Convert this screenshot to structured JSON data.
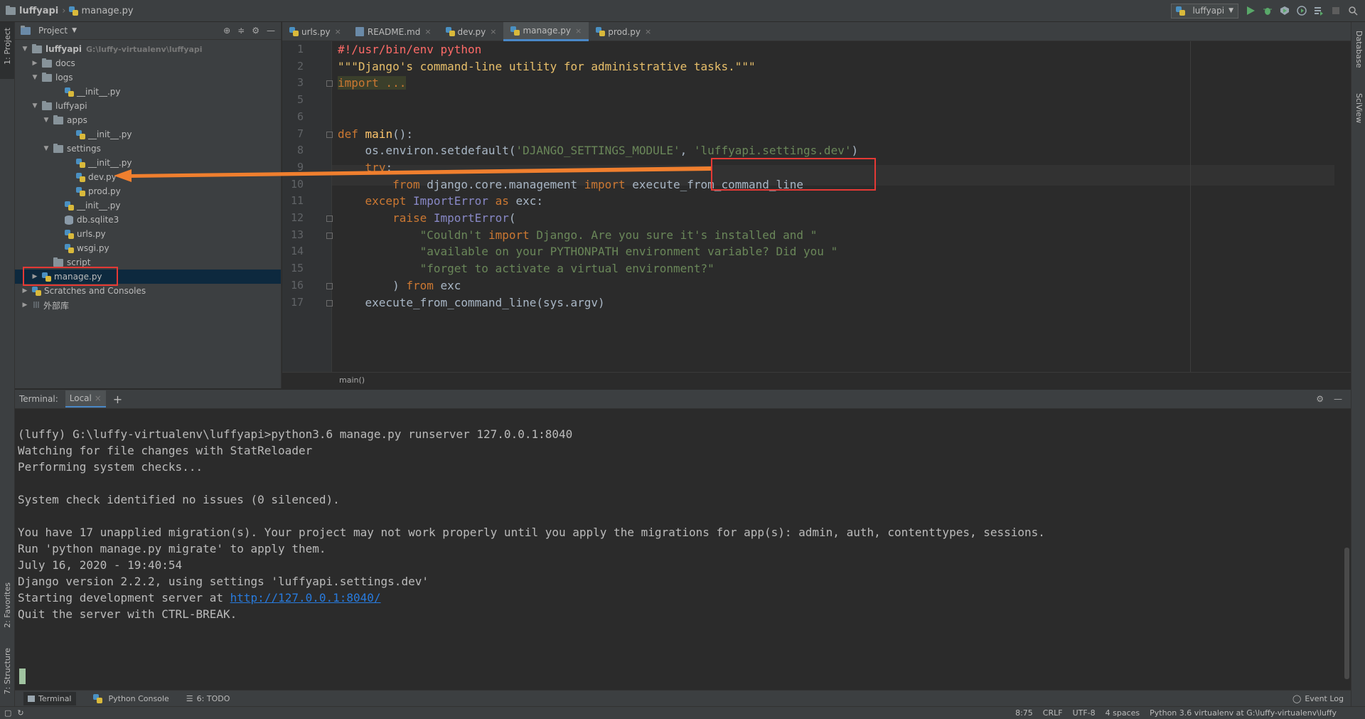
{
  "breadcrumb": {
    "project": "luffyapi",
    "file": "manage.py"
  },
  "run_config": {
    "label": "luffyapi"
  },
  "left_tools": {
    "project": "1: Project",
    "favorites": "2: Favorites",
    "structure": "7: Structure"
  },
  "right_tools": {
    "database": "Database",
    "sciview": "SciView"
  },
  "project_panel": {
    "title": "Project",
    "tree": [
      {
        "label": "luffyapi",
        "path": "G:\\luffy-virtualenv\\luffyapi",
        "depth": 0,
        "twisty": "▼",
        "icon": "folder"
      },
      {
        "label": "docs",
        "depth": 1,
        "twisty": "▶",
        "icon": "folder"
      },
      {
        "label": "logs",
        "depth": 1,
        "twisty": "▼",
        "icon": "folder"
      },
      {
        "label": "__init__.py",
        "depth": 3,
        "twisty": "",
        "icon": "python"
      },
      {
        "label": "luffyapi",
        "depth": 1,
        "twisty": "▼",
        "icon": "folder"
      },
      {
        "label": "apps",
        "depth": 2,
        "twisty": "▼",
        "icon": "folder"
      },
      {
        "label": "__init__.py",
        "depth": 4,
        "twisty": "",
        "icon": "python"
      },
      {
        "label": "settings",
        "depth": 2,
        "twisty": "▼",
        "icon": "folder"
      },
      {
        "label": "__init__.py",
        "depth": 4,
        "twisty": "",
        "icon": "python"
      },
      {
        "label": "dev.py",
        "depth": 4,
        "twisty": "",
        "icon": "python"
      },
      {
        "label": "prod.py",
        "depth": 4,
        "twisty": "",
        "icon": "python"
      },
      {
        "label": "__init__.py",
        "depth": 3,
        "twisty": "",
        "icon": "python"
      },
      {
        "label": "db.sqlite3",
        "depth": 3,
        "twisty": "",
        "icon": "db"
      },
      {
        "label": "urls.py",
        "depth": 3,
        "twisty": "",
        "icon": "python"
      },
      {
        "label": "wsgi.py",
        "depth": 3,
        "twisty": "",
        "icon": "python"
      },
      {
        "label": "script",
        "depth": 2,
        "twisty": "",
        "icon": "folder"
      },
      {
        "label": "manage.py",
        "depth": 1,
        "twisty": "▶",
        "icon": "python",
        "selected": true
      },
      {
        "label": "Scratches and Consoles",
        "depth": 0,
        "twisty": "▶",
        "icon": "scratch"
      },
      {
        "label": "外部库",
        "depth": 0,
        "twisty": "▶",
        "icon": "lib"
      }
    ]
  },
  "tabs": [
    {
      "label": "urls.py",
      "icon": "python"
    },
    {
      "label": "README.md",
      "icon": "md"
    },
    {
      "label": "dev.py",
      "icon": "python"
    },
    {
      "label": "manage.py",
      "icon": "python",
      "active": true
    },
    {
      "label": "prod.py",
      "icon": "python"
    }
  ],
  "editor": {
    "line_numbers": [
      "1",
      "2",
      "3",
      "5",
      "6",
      "7",
      "8",
      "9",
      "10",
      "11",
      "12",
      "13",
      "14",
      "15",
      "16",
      "17"
    ],
    "lines": [
      {
        "num": "1",
        "text": "#!/usr/bin/env python"
      },
      {
        "num": "2",
        "text": "\"\"\"Django's command-line utility for administrative tasks.\"\"\""
      },
      {
        "num": "3",
        "text": "import ..."
      },
      {
        "num": "5",
        "text": ""
      },
      {
        "num": "6",
        "text": ""
      },
      {
        "num": "7",
        "text": "def main():"
      },
      {
        "num": "8",
        "text": "    os.environ.setdefault('DJANGO_SETTINGS_MODULE', 'luffyapi.settings.dev')"
      },
      {
        "num": "9",
        "text": "    try:"
      },
      {
        "num": "10",
        "text": "        from django.core.management import execute_from_command_line"
      },
      {
        "num": "11",
        "text": "    except ImportError as exc:"
      },
      {
        "num": "12",
        "text": "        raise ImportError("
      },
      {
        "num": "13",
        "text": "            \"Couldn't import Django. Are you sure it's installed and \""
      },
      {
        "num": "14",
        "text": "            \"available on your PYTHONPATH environment variable? Did you \""
      },
      {
        "num": "15",
        "text": "            \"forget to activate a virtual environment?\""
      },
      {
        "num": "16",
        "text": "        ) from exc"
      },
      {
        "num": "17",
        "text": "    execute_from_command_line(sys.argv)"
      }
    ],
    "breadcrumb": "main()"
  },
  "terminal": {
    "title": "Terminal:",
    "tab": "Local",
    "add": "+",
    "lines": [
      "(luffy) G:\\luffy-virtualenv\\luffyapi>python3.6 manage.py runserver 127.0.0.1:8040",
      "Watching for file changes with StatReloader",
      "Performing system checks...",
      "",
      "System check identified no issues (0 silenced).",
      "",
      "You have 17 unapplied migration(s). Your project may not work properly until you apply the migrations for app(s): admin, auth, contenttypes, sessions.",
      "Run 'python manage.py migrate' to apply them.",
      "July 16, 2020 - 19:40:54",
      "Django version 2.2.2, using settings 'luffyapi.settings.dev'",
      "Starting development server at ",
      "Quit the server with CTRL-BREAK."
    ],
    "server_url": "http://127.0.0.1:8040/"
  },
  "bottom_tools": {
    "terminal": "Terminal",
    "python_console": "Python Console",
    "todo": "6: TODO",
    "event_log": "Event Log"
  },
  "status": {
    "position": "8:75",
    "line_sep": "CRLF",
    "encoding": "UTF-8",
    "indent": "4 spaces",
    "interpreter": "Python 3.6 virtualenv at G:\\luffy-virtualenv\\luffy"
  },
  "colors": {
    "annotation_red": "#e53935",
    "annotation_arrow": "#f07f2e",
    "accent": "#4a88c7"
  }
}
